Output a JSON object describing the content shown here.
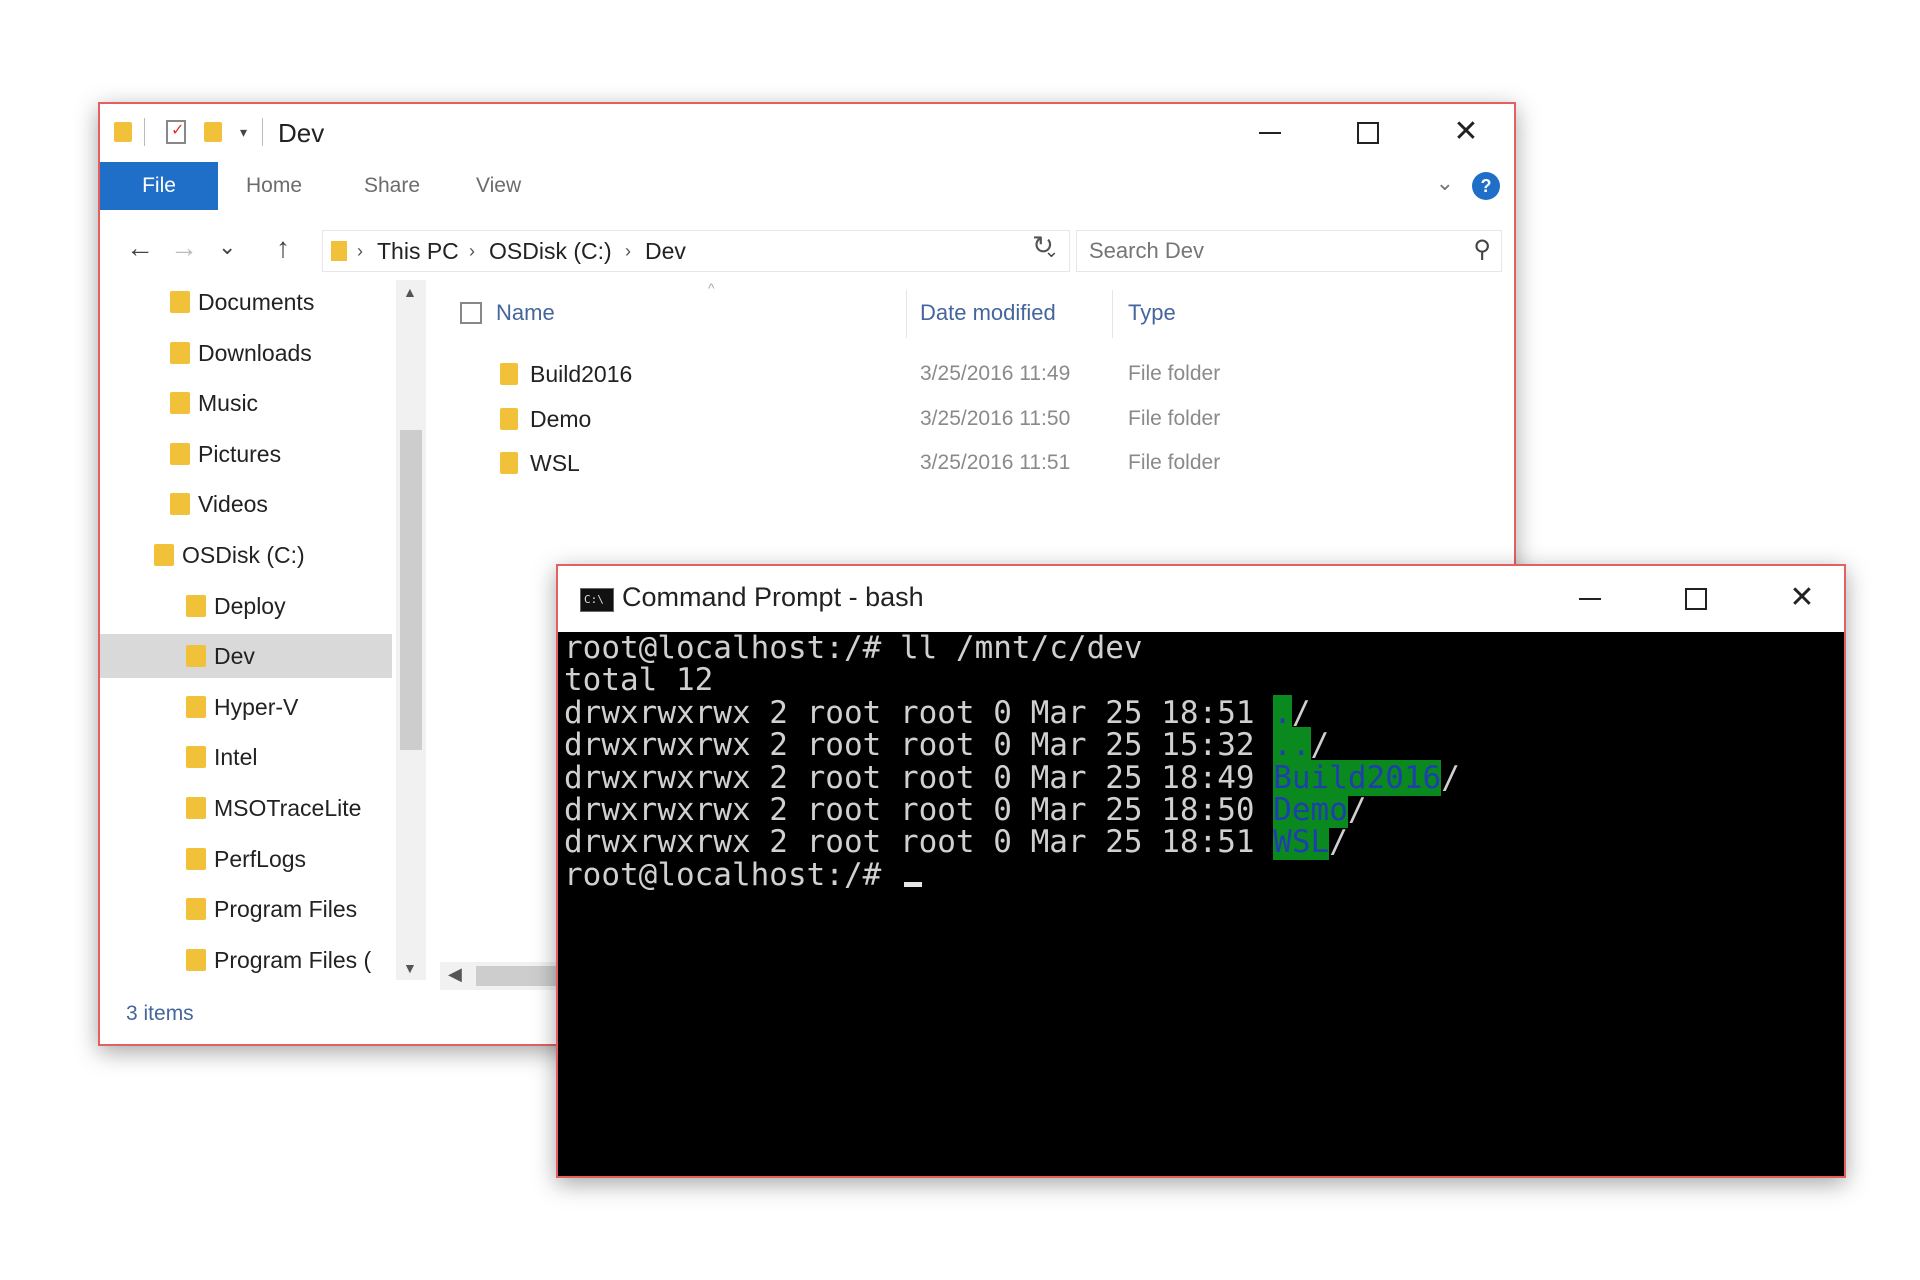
{
  "explorer": {
    "title": "Dev",
    "ribbon": {
      "file": "File",
      "home": "Home",
      "share": "Share",
      "view": "View"
    },
    "address": {
      "crumbs": [
        "This PC",
        "OSDisk (C:)",
        "Dev"
      ]
    },
    "search": {
      "placeholder": "Search Dev"
    },
    "nav": {
      "items": [
        {
          "label": "Documents",
          "selected": false
        },
        {
          "label": "Downloads",
          "selected": false
        },
        {
          "label": "Music",
          "selected": false
        },
        {
          "label": "Pictures",
          "selected": false
        },
        {
          "label": "Videos",
          "selected": false
        },
        {
          "label": "OSDisk (C:)",
          "selected": false
        },
        {
          "label": "Deploy",
          "selected": false
        },
        {
          "label": "Dev",
          "selected": true
        },
        {
          "label": "Hyper-V",
          "selected": false
        },
        {
          "label": "Intel",
          "selected": false
        },
        {
          "label": "MSOTraceLite",
          "selected": false
        },
        {
          "label": "PerfLogs",
          "selected": false
        },
        {
          "label": "Program Files",
          "selected": false
        },
        {
          "label": "Program Files (",
          "selected": false
        }
      ]
    },
    "columns": {
      "name": "Name",
      "date": "Date modified",
      "type": "Type"
    },
    "files": [
      {
        "name": "Build2016",
        "date": "3/25/2016 11:49",
        "type": "File folder"
      },
      {
        "name": "Demo",
        "date": "3/25/2016 11:50",
        "type": "File folder"
      },
      {
        "name": "WSL",
        "date": "3/25/2016 11:51",
        "type": "File folder"
      }
    ],
    "status": "3 items"
  },
  "console": {
    "title": "Command Prompt - bash",
    "icon_text": "C:\\",
    "lines": [
      {
        "text": "root@localhost:/# ll /mnt/c/dev"
      },
      {
        "text": "total 12"
      },
      {
        "text": "drwxrwxrwx 2 root root 0 Mar 25 18:51 ",
        "name": ".",
        "suffix": "/"
      },
      {
        "text": "drwxrwxrwx 2 root root 0 Mar 25 15:32 ",
        "name": "..",
        "suffix": "/"
      },
      {
        "text": "drwxrwxrwx 2 root root 0 Mar 25 18:49 ",
        "name": "Build2016",
        "suffix": "/"
      },
      {
        "text": "drwxrwxrwx 2 root root 0 Mar 25 18:50 ",
        "name": "Demo",
        "suffix": "/"
      },
      {
        "text": "drwxrwxrwx 2 root root 0 Mar 25 18:51 ",
        "name": "WSL",
        "suffix": "/"
      },
      {
        "text": "root@localhost:/# ",
        "cursor": true
      }
    ],
    "colors": {
      "dir_highlight_bg": "#0a8a1e",
      "dir_text": "#1f3fae",
      "background": "#000000"
    }
  },
  "icons": {
    "back": "←",
    "forward": "→",
    "recent": "⌄",
    "up": "↑",
    "refresh": "↻",
    "search": "⚲",
    "minimize": "─",
    "maximize": "☐",
    "close": "✕",
    "chevron": "⌄",
    "help": "?",
    "scroll_up": "▲",
    "scroll_down": "▼",
    "scroll_left": "◀"
  }
}
